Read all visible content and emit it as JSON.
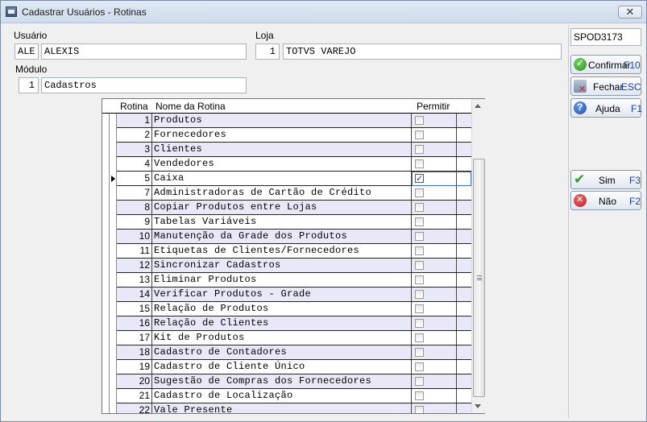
{
  "window": {
    "title": "Cadastrar Usuários - Rotinas",
    "close_glyph": "✕"
  },
  "usuario": {
    "label": "Usuário",
    "code": "ALE",
    "name": "ALEXIS"
  },
  "loja": {
    "label": "Loja",
    "code": "1",
    "name": "TOTVS VAREJO"
  },
  "modulo": {
    "label": "Módulo",
    "code": "1",
    "name": "Cadastros"
  },
  "grid": {
    "headers": {
      "rotina": "Rotina",
      "nome": "Nome da Rotina",
      "permitir": "Permitir"
    },
    "rows": [
      {
        "num": "1",
        "name": "Produtos",
        "checked": false
      },
      {
        "num": "2",
        "name": "Fornecedores",
        "checked": false
      },
      {
        "num": "3",
        "name": "Clientes",
        "checked": false
      },
      {
        "num": "4",
        "name": "Vendedores",
        "checked": false
      },
      {
        "num": "5",
        "name": "Caixa",
        "checked": true,
        "selected": true
      },
      {
        "num": "7",
        "name": "Administradoras de Cartão de Crédito",
        "checked": false
      },
      {
        "num": "8",
        "name": "Copiar Produtos entre Lojas",
        "checked": false
      },
      {
        "num": "9",
        "name": "Tabelas Variáveis",
        "checked": false
      },
      {
        "num": "10",
        "name": "Manutenção da Grade dos Produtos",
        "checked": false
      },
      {
        "num": "11",
        "name": "Etiquetas de Clientes/Fornecedores",
        "checked": false
      },
      {
        "num": "12",
        "name": "Sincronizar Cadastros",
        "checked": false
      },
      {
        "num": "13",
        "name": "Eliminar Produtos",
        "checked": false
      },
      {
        "num": "14",
        "name": "Verificar Produtos - Grade",
        "checked": false
      },
      {
        "num": "15",
        "name": "Relação de Produtos",
        "checked": false
      },
      {
        "num": "16",
        "name": "Relação de Clientes",
        "checked": false
      },
      {
        "num": "17",
        "name": "Kit de Produtos",
        "checked": false
      },
      {
        "num": "18",
        "name": "Cadastro de Contadores",
        "checked": false
      },
      {
        "num": "19",
        "name": "Cadastro de Cliente Único",
        "checked": false
      },
      {
        "num": "20",
        "name": "Sugestão de Compras dos Fornecedores",
        "checked": false
      },
      {
        "num": "21",
        "name": "Cadastro de Localização",
        "checked": false
      },
      {
        "num": "22",
        "name": "Vale Presente",
        "checked": false
      }
    ]
  },
  "side": {
    "code_field": "SPOD3173",
    "buttons": {
      "confirmar": {
        "label": "Confirmar",
        "key": "F10"
      },
      "fechar": {
        "label": "Fechar",
        "key": "ESC"
      },
      "ajuda": {
        "label": "Ajuda",
        "key": "F1"
      },
      "sim": {
        "label": "Sim",
        "key": "F3"
      },
      "nao": {
        "label": "Não",
        "key": "F2"
      }
    }
  },
  "colors": {
    "row_alt": "#e8e8f8",
    "key_text": "#1b3fa5",
    "selection_border": "#3a6fc4"
  }
}
